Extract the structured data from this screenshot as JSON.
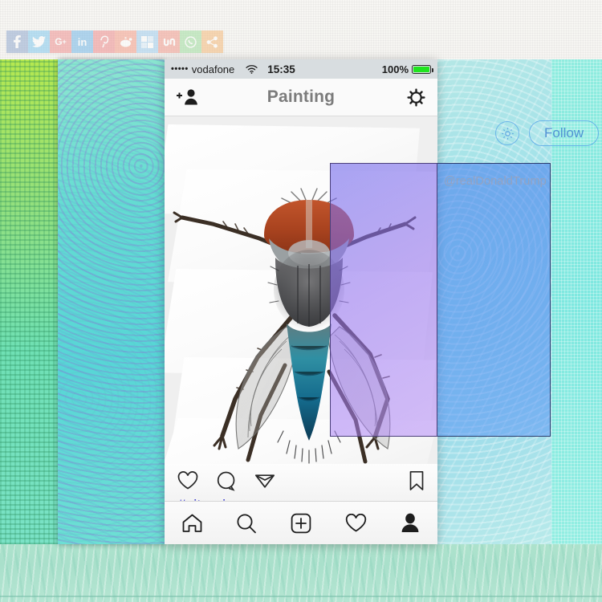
{
  "social_bar": {
    "name": "social-share-bar",
    "buttons": [
      {
        "id": "facebook",
        "label": "f",
        "color": "#8fa8cf"
      },
      {
        "id": "twitter",
        "label": "",
        "color": "#7fc9ef"
      },
      {
        "id": "googleplus",
        "label": "G+",
        "color": "#ef8e8e"
      },
      {
        "id": "linkedin",
        "label": "in",
        "color": "#6fb6e8"
      },
      {
        "id": "pinterest",
        "label": "P",
        "color": "#ef8a8a"
      },
      {
        "id": "reddit",
        "label": "",
        "color": "#f59b86"
      },
      {
        "id": "delicious",
        "label": "",
        "color": "#9dcdf0"
      },
      {
        "id": "stumbleupon",
        "label": "su",
        "color": "#f2998b"
      },
      {
        "id": "whatsapp",
        "label": "",
        "color": "#9ede9e"
      },
      {
        "id": "share",
        "label": "",
        "color": "#f5b877"
      }
    ]
  },
  "phone": {
    "status_bar": {
      "signal_dots": "•••••",
      "carrier": "vodafone",
      "wifi_icon": "wifi-icon",
      "time": "15:35",
      "battery_percent": "100%",
      "battery_level": 100
    },
    "nav_bar": {
      "left_icon": "add-person-icon",
      "title": "Painting",
      "right_icon": "settings-gear-icon"
    },
    "post": {
      "image_subject": "macro photograph of a housefly",
      "actions": {
        "like": "heart-icon",
        "comment": "comment-bubble-icon",
        "share": "paper-plane-icon",
        "save": "bookmark-icon"
      },
      "caption": "#vitruvius"
    },
    "tab_bar": {
      "items": [
        {
          "id": "home",
          "icon": "home-icon"
        },
        {
          "id": "search",
          "icon": "search-icon"
        },
        {
          "id": "add",
          "icon": "plus-square-icon"
        },
        {
          "id": "activity",
          "icon": "heart-icon"
        },
        {
          "id": "profile",
          "icon": "person-icon"
        }
      ]
    }
  },
  "right_overlay": {
    "gear_icon": "gear-icon",
    "follow_label": "Follow",
    "handle": "@realDonaldTrump"
  },
  "overlays": {
    "purple_rect": {
      "name": "purple-selection-rect",
      "fill": "#8c78ec",
      "border": "#4b3f7a"
    },
    "blue_rect": {
      "name": "blue-selection-rect",
      "fill": "#4a82ee",
      "border": "#2c3c6e"
    }
  },
  "background": {
    "canvas_color": "#f3f2ef",
    "mint_color": "#aee3cd",
    "lime_strip": "#95e07a",
    "swirl_strip": "#64dcd2",
    "cyan_strip": "#9fe1ea",
    "turquoise_strip": "#7ee8e0"
  }
}
